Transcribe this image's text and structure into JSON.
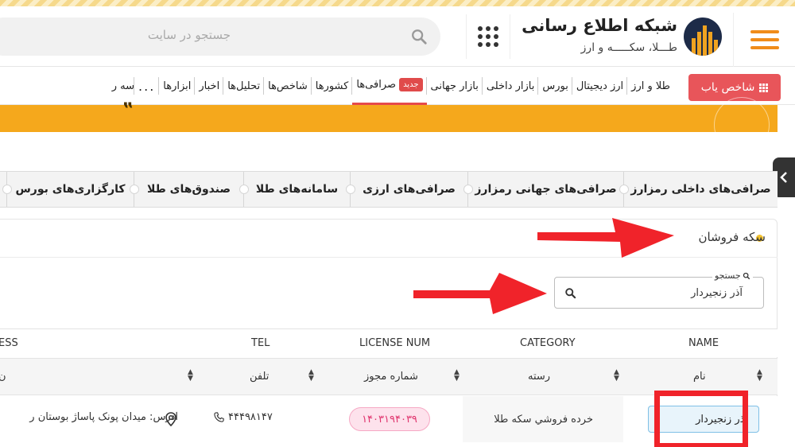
{
  "header": {
    "search_placeholder": "جستجو در سایت",
    "brand_title": "شبکه اطلاع رسانی",
    "brand_subtitle": "طـــلا، سکـــــه و ارز"
  },
  "nav": {
    "shakhes_button": "شاخص یاب",
    "items": [
      {
        "label": "طلا و ارز"
      },
      {
        "label": "ارز دیجیتال"
      },
      {
        "label": "بورس"
      },
      {
        "label": "بازار داخلی"
      },
      {
        "label": "بازار جهانی"
      },
      {
        "label": "صرافی‌ها",
        "badge": "جدید"
      },
      {
        "label": "کشورها"
      },
      {
        "label": "شاخص‌ها"
      },
      {
        "label": "تحلیل‌ها"
      },
      {
        "label": "اخبار"
      },
      {
        "label": "ابزارها"
      },
      {
        "label": "..."
      },
      {
        "label": "سه ر"
      }
    ]
  },
  "category_tabs": [
    "صرافی‌های داخلی رمزارز",
    "صرافی‌های جهانی رمزارز",
    "صرافی‌های ارزی",
    "سامانه‌های طلا",
    "صندوق‌های طلا",
    "کارگزاری‌های بورس"
  ],
  "card": {
    "title": "سکه فروشان",
    "search_label": "جستجو",
    "search_value": "آذر زنجیردار"
  },
  "table": {
    "headers_en": {
      "name": "NAME",
      "category": "CATEGORY",
      "license": "LICENSE NUM",
      "tel": "TEL",
      "address": "ESS"
    },
    "headers_fa": {
      "name": "نام",
      "category": "رسته",
      "license": "شماره مجوز",
      "tel": "تلفن",
      "address": "ن"
    },
    "rows": [
      {
        "name": "آذر زنجیردار",
        "category": "خرده فروشي سکه طلا",
        "license": "۱۴۰۳۱۹۴۰۳۹",
        "tel": "۴۴۴۹۸۱۴۷",
        "address": "آدرس: میدان پونک پاساژ بوستان ر"
      }
    ]
  },
  "colors": {
    "accent_orange": "#f5a81c",
    "nav_button_red": "#e8555a",
    "annotation_red": "#f0232a",
    "license_badge_pink": "#fde2ec"
  }
}
